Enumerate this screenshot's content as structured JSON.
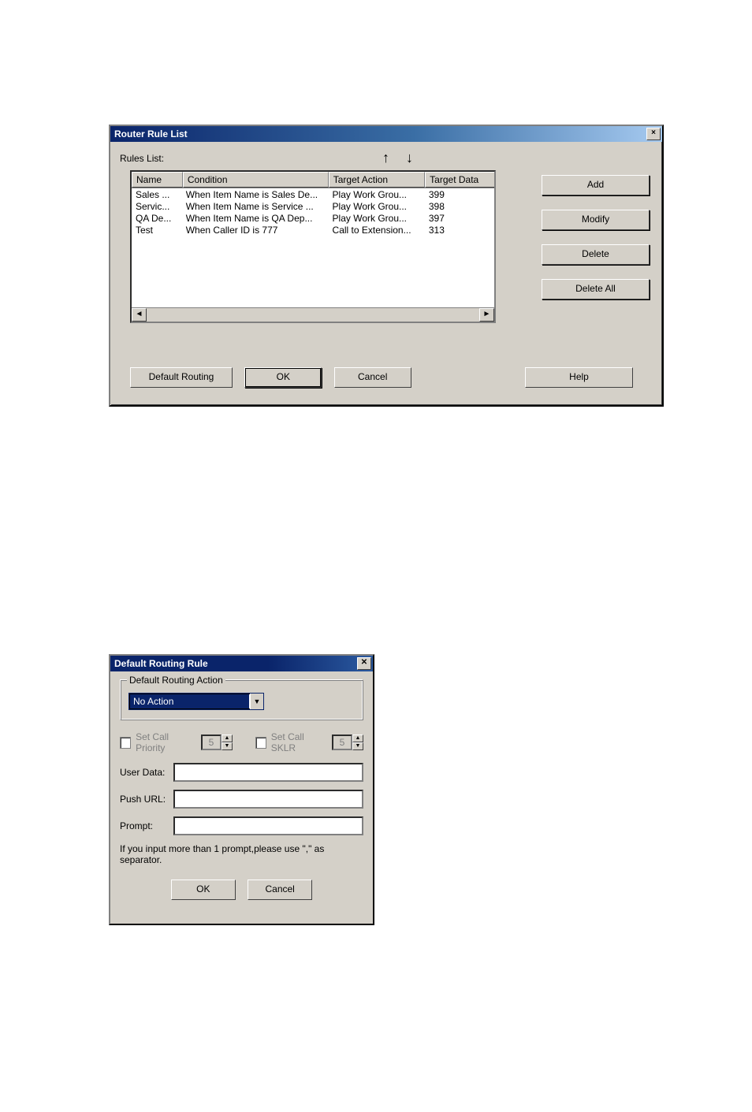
{
  "dialog1": {
    "title": "Router Rule List",
    "rules_label": "Rules List:",
    "arrow_up": "↑",
    "arrow_down": "↓",
    "columns": {
      "name": "Name",
      "condition": "Condition",
      "target_action": "Target Action",
      "target_data": "Target Data"
    },
    "rows": [
      {
        "name": "Sales ...",
        "condition": "When Item Name is Sales De...",
        "action": "Play Work Grou...",
        "data": "399"
      },
      {
        "name": "Servic...",
        "condition": "When Item Name is Service ...",
        "action": "Play Work Grou...",
        "data": "398"
      },
      {
        "name": "QA De...",
        "condition": "When Item Name is QA Dep...",
        "action": "Play Work Grou...",
        "data": "397"
      },
      {
        "name": "Test",
        "condition": "When Caller ID is 777",
        "action": "Call to Extension...",
        "data": "313"
      }
    ],
    "buttons": {
      "add": "Add",
      "modify": "Modify",
      "delete": "Delete",
      "delete_all": "Delete All",
      "default_routing": "Default Routing",
      "ok": "OK",
      "cancel": "Cancel",
      "help": "Help"
    },
    "scroll_left": "◄",
    "scroll_right": "►"
  },
  "dialog2": {
    "title": "Default Routing Rule",
    "groupbox_label": "Default Routing Action",
    "actions_selected": "No Action",
    "set_priority_label": "Set Call Priority",
    "set_priority_value": "5",
    "set_sklr_label": "Set Call SKLR",
    "set_sklr_value": "5",
    "user_data_label": "User Data:",
    "push_url_label": "Push URL:",
    "prompt_label": "Prompt:",
    "hint": "If you input more than 1 prompt,please use \",\" as separator.",
    "ok": "OK",
    "cancel": "Cancel",
    "close_glyph": "✕",
    "combo_arrow": "▼",
    "spin_up": "▲",
    "spin_down": "▼"
  }
}
